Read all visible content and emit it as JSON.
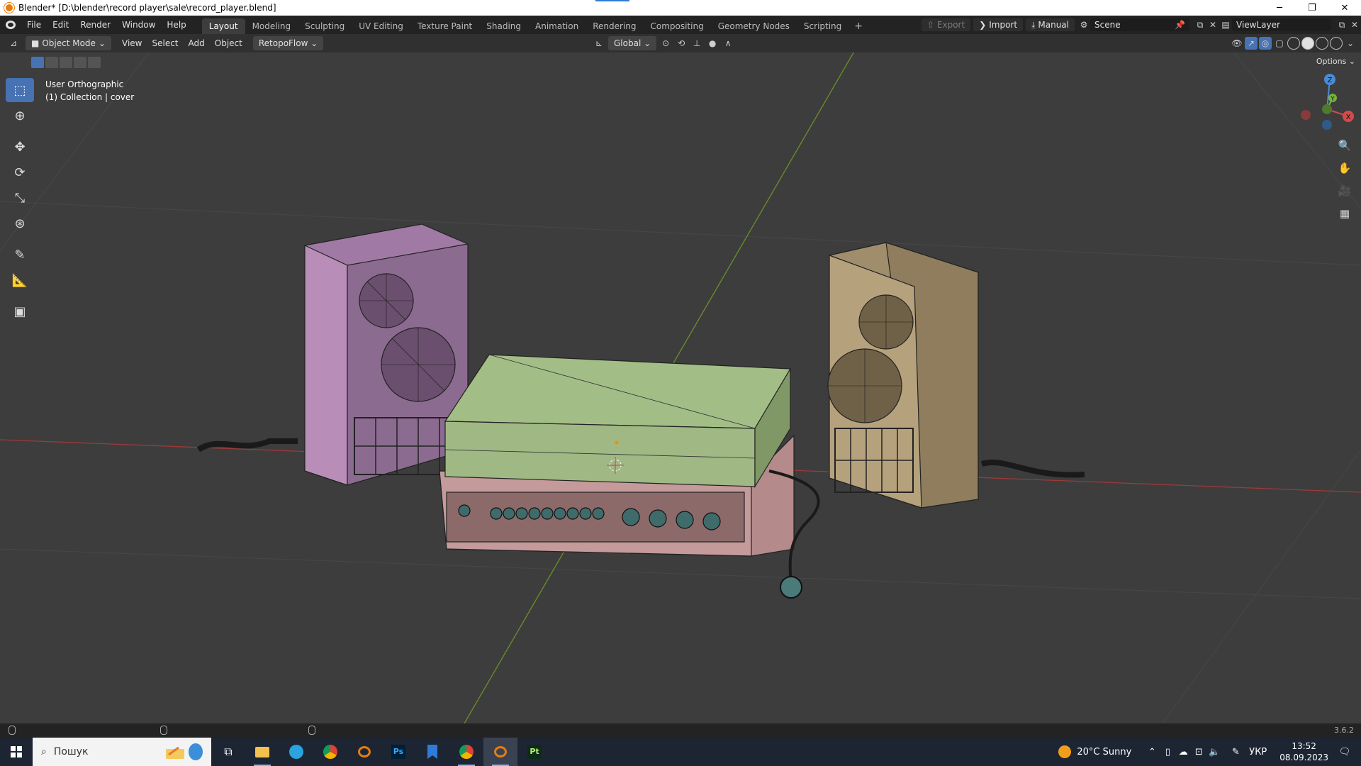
{
  "window": {
    "title": "Blender* [D:\\blender\\record player\\sale\\record_player.blend]",
    "controls": {
      "minimize": "─",
      "maximize": "❐",
      "close": "✕"
    }
  },
  "menu": [
    "File",
    "Edit",
    "Render",
    "Window",
    "Help"
  ],
  "workspaces": [
    "Layout",
    "Modeling",
    "Sculpting",
    "UV Editing",
    "Texture Paint",
    "Shading",
    "Animation",
    "Rendering",
    "Compositing",
    "Geometry Nodes",
    "Scripting"
  ],
  "workspace_add": "+",
  "topbar_right": {
    "export": "Export",
    "import": "Import",
    "manual": "Manual",
    "scene": "Scene",
    "view_layer": "ViewLayer"
  },
  "header": {
    "mode": "Object Mode",
    "menus": [
      "View",
      "Select",
      "Add",
      "Object"
    ],
    "addon": "RetopoFlow",
    "orientation": "Global"
  },
  "viewport": {
    "options": "Options",
    "view_name": "User Orthographic",
    "collection": "(1) Collection | cover",
    "gizmo_axes": {
      "z": "Z",
      "y": "Y",
      "x": "X"
    }
  },
  "status": {
    "version": "3.6.2"
  },
  "taskbar": {
    "search_placeholder": "Пошук",
    "weather": "20°C  Sunny",
    "lang": "УКР",
    "time": "13:52",
    "date": "08.09.2023",
    "apps": [
      "Task View",
      "File Explorer",
      "Telegram",
      "Chrome",
      "Blender",
      "Photoshop",
      "Bookmarks",
      "Chrome",
      "Blender",
      "Substance Painter"
    ]
  }
}
